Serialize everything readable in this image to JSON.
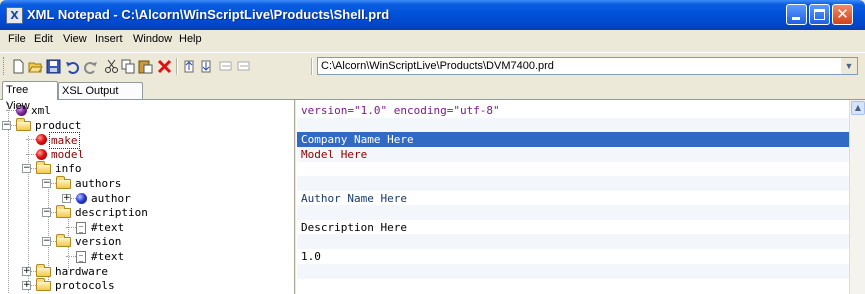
{
  "window": {
    "title": "XML Notepad - C:\\Alcorn\\WinScriptLive\\Products\\Shell.prd",
    "icon_letter": "X"
  },
  "menu": [
    "File",
    "Edit",
    "View",
    "Insert",
    "Window",
    "Help"
  ],
  "toolbar": {
    "buttons": [
      "new-icon",
      "open-icon",
      "save-icon",
      "undo-icon",
      "redo-icon",
      "cut-icon",
      "copy-icon",
      "paste-icon",
      "delete-icon",
      "nudge-up-icon",
      "nudge-down-icon",
      "nudge-left-icon",
      "nudge-right-icon"
    ],
    "path": "C:\\Alcorn\\WinScriptLive\\Products\\DVM7400.prd"
  },
  "tabs": [
    "Tree View",
    "XSL Output"
  ],
  "tree": [
    {
      "label": "xml",
      "icon": "purple-ball-icon",
      "depth": 0
    },
    {
      "label": "product",
      "icon": "folder-icon",
      "depth": 0,
      "expander": "−"
    },
    {
      "label": "make",
      "icon": "red-ball-icon",
      "depth": 1,
      "selected": true
    },
    {
      "label": "model",
      "icon": "red-ball-icon",
      "depth": 1
    },
    {
      "label": "info",
      "icon": "folder-icon",
      "depth": 1,
      "expander": "−"
    },
    {
      "label": "authors",
      "icon": "folder-icon",
      "depth": 2,
      "expander": "−"
    },
    {
      "label": "author",
      "icon": "blue-ball-icon",
      "depth": 3,
      "expander": "+"
    },
    {
      "label": "description",
      "icon": "folder-icon",
      "depth": 2,
      "expander": "−"
    },
    {
      "label": "#text",
      "icon": "text-icon",
      "depth": 3
    },
    {
      "label": "version",
      "icon": "folder-icon",
      "depth": 2,
      "expander": "−"
    },
    {
      "label": "#text",
      "icon": "text-icon",
      "depth": 3
    },
    {
      "label": "hardware",
      "icon": "folder-icon",
      "depth": 1,
      "expander": "+"
    },
    {
      "label": "protocols",
      "icon": "folder-icon",
      "depth": 1,
      "expander": "+"
    }
  ],
  "values": [
    {
      "text": "version=\"1.0\" encoding=\"utf-8\"",
      "style": "purple"
    },
    {
      "text": "",
      "style": ""
    },
    {
      "text": "Company Name Here",
      "style": "selected"
    },
    {
      "text": "Model Here",
      "style": "red"
    },
    {
      "text": "",
      "style": ""
    },
    {
      "text": "",
      "style": ""
    },
    {
      "text": "Author Name Here",
      "style": "navy"
    },
    {
      "text": "",
      "style": ""
    },
    {
      "text": "Description Here",
      "style": ""
    },
    {
      "text": "",
      "style": ""
    },
    {
      "text": "1.0",
      "style": ""
    },
    {
      "text": "",
      "style": ""
    },
    {
      "text": "",
      "style": ""
    }
  ]
}
